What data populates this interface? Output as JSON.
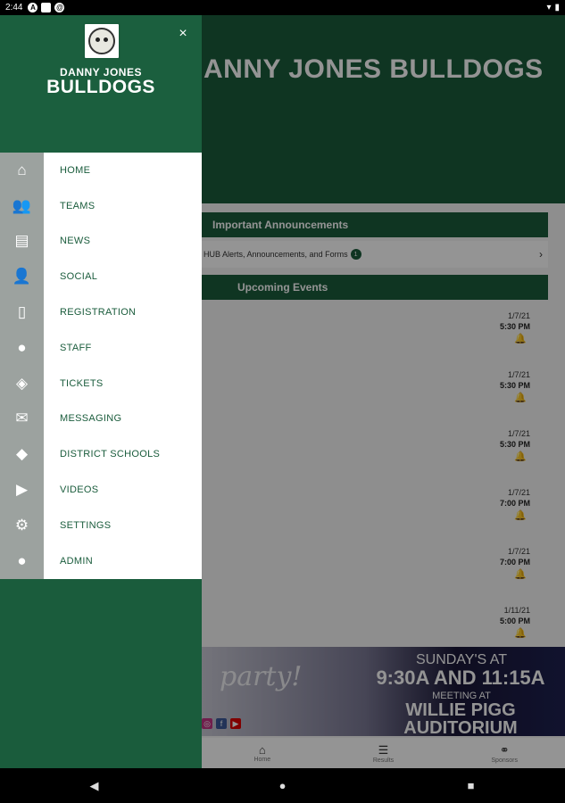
{
  "status_bar": {
    "time": "2:44",
    "left_icons": [
      "A",
      "sd",
      "@"
    ]
  },
  "app": {
    "hero_title": "ANNY JONES BULLDOGS",
    "announcements_header": "Important Announcements",
    "announcements_row": {
      "text": "HUB Alerts, Announcements, and Forms",
      "count": "1"
    },
    "events_header": "Upcoming Events",
    "events": [
      {
        "date": "1/7/21",
        "time": "5:30 PM"
      },
      {
        "date": "1/7/21",
        "time": "5:30 PM"
      },
      {
        "date": "1/7/21",
        "time": "5:30 PM"
      },
      {
        "date": "1/7/21",
        "time": "7:00 PM"
      },
      {
        "date": "1/7/21",
        "time": "7:00 PM"
      },
      {
        "date": "1/11/21",
        "time": "5:00 PM"
      }
    ],
    "banner": {
      "script_text": "party!",
      "line1": "SUNDAY'S AT",
      "line2": "9:30A AND 11:15A",
      "line3": "MEETING AT",
      "line4": "WILLIE PIGG",
      "line5": "AUDITORIUM"
    },
    "tabs": [
      {
        "label": "Home",
        "icon": "home-icon"
      },
      {
        "label": "Results",
        "icon": "list-icon"
      },
      {
        "label": "Sponsors",
        "icon": "handshake-icon"
      }
    ]
  },
  "drawer": {
    "logo_line1": "DANNY JONES",
    "logo_line2": "BULLDOGS",
    "close_glyph": "×",
    "menu_items": [
      {
        "label": "HOME",
        "icon": "home-icon"
      },
      {
        "label": "TEAMS",
        "icon": "users-icon"
      },
      {
        "label": "NEWS",
        "icon": "newspaper-icon"
      },
      {
        "label": "SOCIAL",
        "icon": "user-plus-icon"
      },
      {
        "label": "REGISTRATION",
        "icon": "document-icon"
      },
      {
        "label": "STAFF",
        "icon": "person-icon"
      },
      {
        "label": "TICKETS",
        "icon": "ticket-icon"
      },
      {
        "label": "MESSAGING",
        "icon": "envelope-icon"
      },
      {
        "label": "DISTRICT SCHOOLS",
        "icon": "graduation-cap-icon"
      },
      {
        "label": "VIDEOS",
        "icon": "play-icon"
      },
      {
        "label": "SETTINGS",
        "icon": "gear-icon"
      },
      {
        "label": "ADMIN",
        "icon": "admin-icon"
      }
    ]
  },
  "colors": {
    "brand_green": "#1a5c3c",
    "rail_gray": "#9ca29f"
  }
}
